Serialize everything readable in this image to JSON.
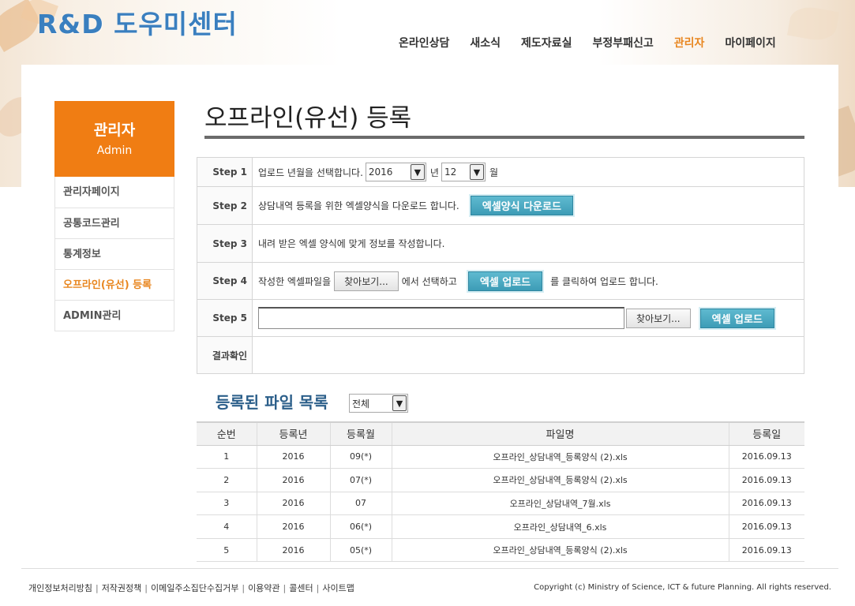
{
  "logo": "R&D 도우미센터",
  "gnb": [
    {
      "label": "온라인상담",
      "active": false
    },
    {
      "label": "새소식",
      "active": false
    },
    {
      "label": "제도자료실",
      "active": false
    },
    {
      "label": "부정부패신고",
      "active": false
    },
    {
      "label": "관리자",
      "active": true
    },
    {
      "label": "마이페이지",
      "active": false
    }
  ],
  "sidebar": {
    "title": "관리자",
    "subtitle": "Admin",
    "items": [
      {
        "label": "관리자페이지",
        "active": false
      },
      {
        "label": "공통코드관리",
        "active": false
      },
      {
        "label": "통계정보",
        "active": false
      },
      {
        "label": "오프라인(유선) 등록",
        "active": true
      },
      {
        "label": "ADMIN관리",
        "active": false
      }
    ]
  },
  "page_title": "오프라인(유선) 등록",
  "steps": {
    "step1": {
      "label": "Step 1",
      "text": "업로드 년월을 선택합니다.",
      "year": "2016",
      "year_unit": "년",
      "month": "12",
      "month_unit": "월"
    },
    "step2": {
      "label": "Step 2",
      "text": "상담내역 등록을 위한 엑셀양식을 다운로드 합니다.",
      "button": "엑셀양식 다운로드"
    },
    "step3": {
      "label": "Step 3",
      "text": "내려 받은 엑셀 양식에 맞게 정보를 작성합니다."
    },
    "step4": {
      "label": "Step 4",
      "text_a": "작성한 엑셀파일을",
      "browse": "찾아보기...",
      "text_b": "에서 선택하고",
      "button": "엑셀 업로드",
      "text_c": "를 클릭하여 업로드 합니다."
    },
    "step5": {
      "label": "Step 5",
      "browse": "찾아보기...",
      "button": "엑셀 업로드"
    },
    "result": {
      "label": "결과확인"
    }
  },
  "file_list": {
    "title": "등록된 파일 목록",
    "filter": "전체",
    "columns": [
      "순번",
      "등록년",
      "등록월",
      "파일명",
      "등록일"
    ],
    "rows": [
      [
        "1",
        "2016",
        "09(*)",
        "오프라인_상담내역_등록양식 (2).xls",
        "2016.09.13"
      ],
      [
        "2",
        "2016",
        "07(*)",
        "오프라인_상담내역_등록양식 (2).xls",
        "2016.09.13"
      ],
      [
        "3",
        "2016",
        "07",
        "오프라인_상담내역_7월.xls",
        "2016.09.13"
      ],
      [
        "4",
        "2016",
        "06(*)",
        "오프라인_상담내역_6.xls",
        "2016.09.13"
      ],
      [
        "5",
        "2016",
        "05(*)",
        "오프라인_상담내역_등록양식 (2).xls",
        "2016.09.13"
      ]
    ]
  },
  "footer": {
    "links": [
      "개인정보처리방침",
      "저작권정책",
      "이메일주소집단수집거부",
      "이용약관",
      "콜센터",
      "사이트맵"
    ],
    "copyright": "Copyright (c) Ministry of Science, ICT & future Planning. All rights reserved."
  },
  "colors": {
    "accent": "#f07d13",
    "logo": "#3a7fbf",
    "button": "#3d9cb6",
    "list_title": "#2c5f8a"
  }
}
